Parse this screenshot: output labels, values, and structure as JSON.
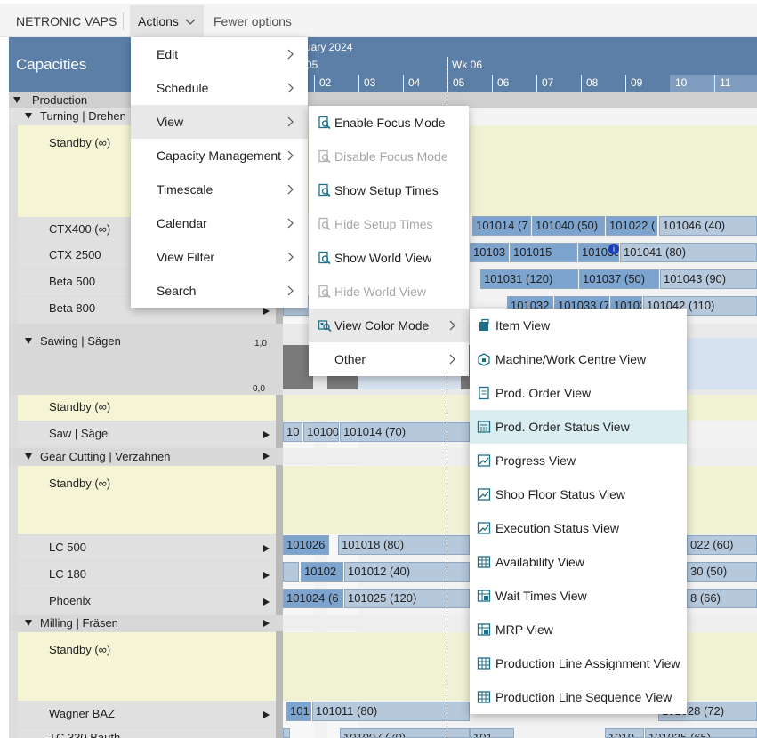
{
  "app": {
    "name": "NETRONIC VAPS"
  },
  "toolbar": {
    "actions_label": "Actions",
    "fewer_label": "Fewer options"
  },
  "gantt": {
    "title": "Capacities",
    "month_label": "uary 2024",
    "week_labels": [
      "05",
      "Wk 06"
    ],
    "days": [
      "02",
      "03",
      "04",
      "05",
      "06",
      "07",
      "08",
      "09",
      "10",
      "11"
    ],
    "axis_labels": [
      "1,0",
      "0,0"
    ]
  },
  "rows": {
    "production": "Production",
    "turning": "Turning | Drehen",
    "standby1": "Standby (∞)",
    "ctx400": "CTX400 (∞)",
    "ctx2500": "CTX 2500",
    "beta500": "Beta 500",
    "beta800": "Beta 800",
    "sawing": "Sawing | Sägen",
    "standby2": "Standby (∞)",
    "saw": "Saw | Säge",
    "gear": "Gear Cutting | Verzahnen",
    "standby3": "Standby (∞)",
    "lc500": "LC 500",
    "lc180": "LC 180",
    "phoenix": "Phoenix",
    "milling": "Milling | Fräsen",
    "standby4": "Standby (∞)",
    "wagner": "Wagner BAZ",
    "tc": "TC 330 Bauth"
  },
  "bars": {
    "b1": "101014 (7",
    "b2": "101040 (50)",
    "b3": "101022 (",
    "b4": "101046 (40)",
    "b5": "10103",
    "b6": "101015",
    "b7": "101035 (6",
    "b8": "101041 (80)",
    "b9": "101031 (120)",
    "b10": "101037 (50)",
    "b11": "101043 (90)",
    "b12": "101032",
    "b13": "101033 (7",
    "b14": "10103",
    "b15": "101042 (110)",
    "b16": "10",
    "b17": "10100",
    "b18": "101014 (70)",
    "b19": "101026",
    "b20": "101018 (80)",
    "b21": "022 (60)",
    "b22": "10102",
    "b23": "101012 (40)",
    "b24": "30 (50)",
    "b25": "101024 (6",
    "b26": "101025 (120)",
    "b27": "8 (66)",
    "b28": "101",
    "b29": "101011 (80)",
    "b30": "101028 (72)",
    "b31": "101007 (70)",
    "b32": "101035 (65)",
    "b33": "101",
    "b34": "1010"
  },
  "actions_menu": {
    "items": [
      "Edit",
      "Schedule",
      "View",
      "Capacity Management",
      "Timescale",
      "Calendar",
      "View Filter",
      "Search"
    ]
  },
  "view_menu": {
    "items": [
      "Enable Focus Mode",
      "Disable Focus Mode",
      "Show Setup Times",
      "Hide Setup Times",
      "Show World View",
      "Hide World View",
      "View Color Mode",
      "Other"
    ]
  },
  "color_menu": {
    "items": [
      "Item View",
      "Machine/Work Centre View",
      "Prod. Order View",
      "Prod. Order Status View",
      "Progress View",
      "Shop Floor Status View",
      "Execution Status View",
      "Availability View",
      "Wait Times View",
      "MRP View",
      "Production Line Assignment View",
      "Production Line Sequence View"
    ]
  },
  "colors": {
    "header": "#5b7fa6",
    "standby": "#f5f5d6",
    "bar": "#b6c8dc",
    "bar_dark": "#7da4cf"
  }
}
